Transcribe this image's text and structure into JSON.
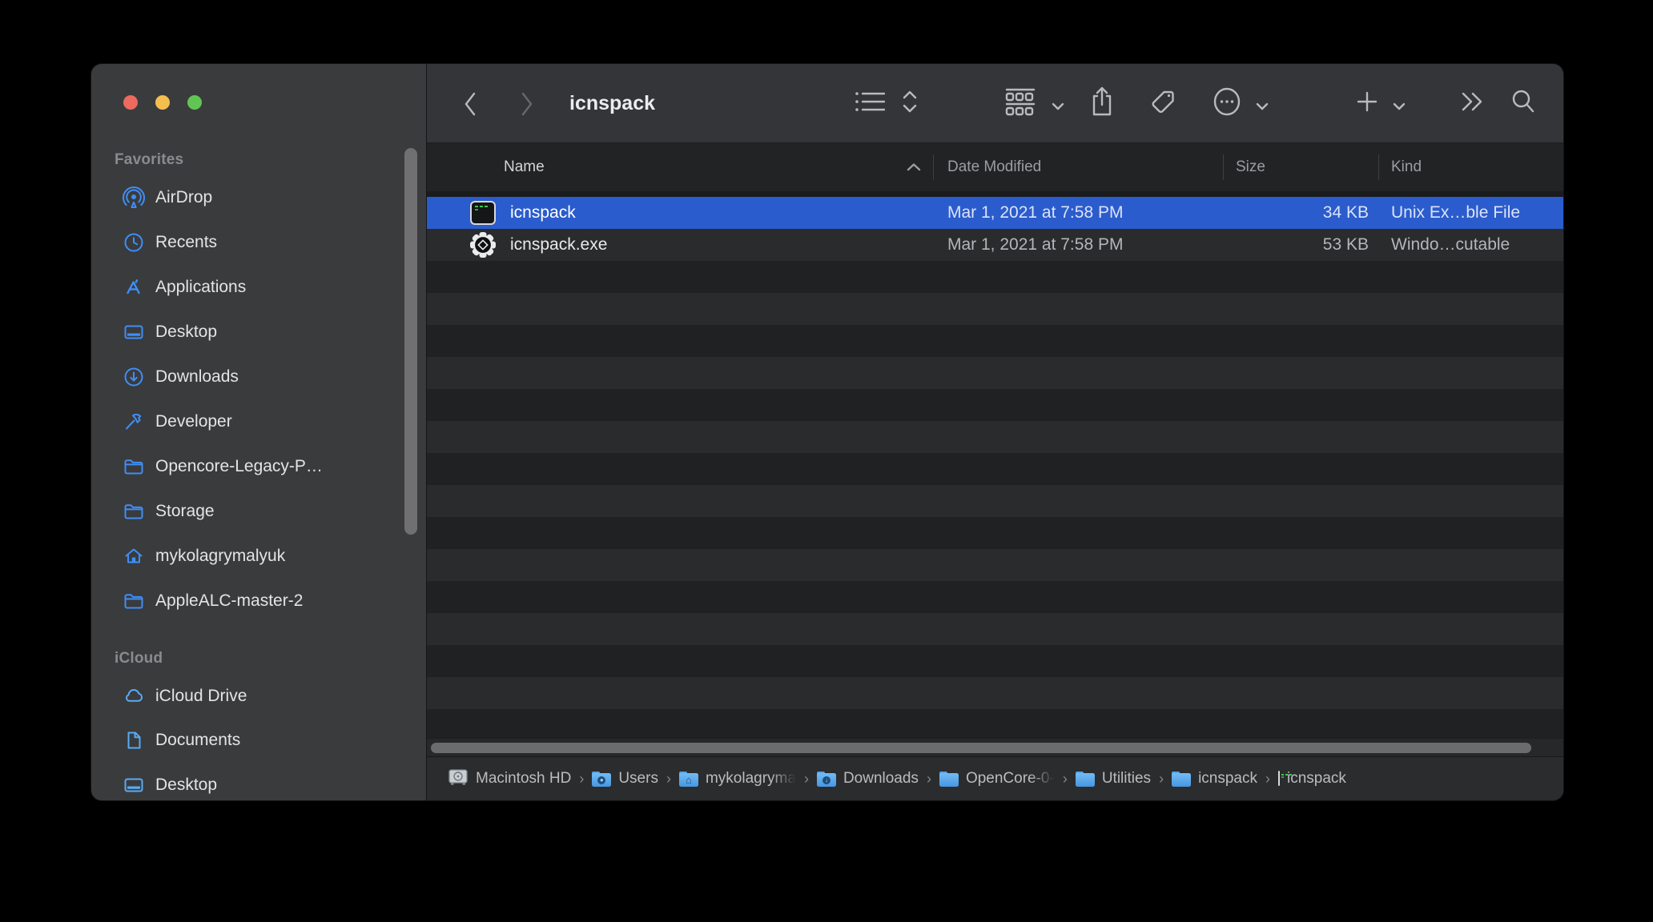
{
  "window": {
    "title": "icnspack"
  },
  "sidebar": {
    "sections": [
      {
        "label": "Favorites",
        "items": [
          {
            "label": "AirDrop",
            "icon": "airdrop-icon"
          },
          {
            "label": "Recents",
            "icon": "clock-icon"
          },
          {
            "label": "Applications",
            "icon": "appstore-a-icon"
          },
          {
            "label": "Desktop",
            "icon": "desktop-icon"
          },
          {
            "label": "Downloads",
            "icon": "download-circle-icon"
          },
          {
            "label": "Developer",
            "icon": "hammer-icon"
          },
          {
            "label": "Opencore-Legacy-P…",
            "icon": "folder-icon"
          },
          {
            "label": "Storage",
            "icon": "folder-icon"
          },
          {
            "label": "mykolagrymalyuk",
            "icon": "home-icon"
          },
          {
            "label": "AppleALC-master-2",
            "icon": "folder-icon"
          }
        ]
      },
      {
        "label": "iCloud",
        "items": [
          {
            "label": "iCloud Drive",
            "icon": "cloud-icon"
          },
          {
            "label": "Documents",
            "icon": "document-icon"
          },
          {
            "label": "Desktop",
            "icon": "desktop-icon"
          }
        ]
      }
    ]
  },
  "list": {
    "columns": {
      "name": "Name",
      "date": "Date Modified",
      "size": "Size",
      "kind": "Kind"
    },
    "sort": {
      "column": "Name",
      "direction": "ascending"
    },
    "rows": [
      {
        "name": "icnspack",
        "date": "Mar 1, 2021 at 7:58 PM",
        "size": "34 KB",
        "kind": "Unix Ex…ble File",
        "icon": "terminal-executable-icon",
        "selected": true
      },
      {
        "name": "icnspack.exe",
        "date": "Mar 1, 2021 at 7:58 PM",
        "size": "53 KB",
        "kind": "Windo…cutable",
        "icon": "exe-gear-icon",
        "selected": false
      }
    ]
  },
  "pathbar": {
    "items": [
      {
        "label": "Macintosh HD",
        "icon": "hard-drive-icon"
      },
      {
        "label": "Users",
        "icon": "users-folder-icon"
      },
      {
        "label": "mykolagryma",
        "icon": "home-folder-icon",
        "truncated": true
      },
      {
        "label": "Downloads",
        "icon": "downloads-folder-icon"
      },
      {
        "label": "OpenCore-0-",
        "icon": "folder-icon",
        "truncated": true
      },
      {
        "label": "Utilities",
        "icon": "folder-icon"
      },
      {
        "label": "icnspack",
        "icon": "folder-icon"
      },
      {
        "label": "icnspack",
        "icon": "terminal-executable-icon"
      }
    ]
  },
  "colors": {
    "selection_blue": "#2b5ccd",
    "sidebar_bg": "#3a3b3d",
    "toolbar_bg": "#333538",
    "sidebar_icon_blue": "#3f8ef7",
    "icloud_icon_blue": "#58abf4",
    "traffic_red": "#ed6a5e",
    "traffic_yellow": "#f5bf4f",
    "traffic_green": "#61c554",
    "terminal_green": "#39c94f"
  }
}
